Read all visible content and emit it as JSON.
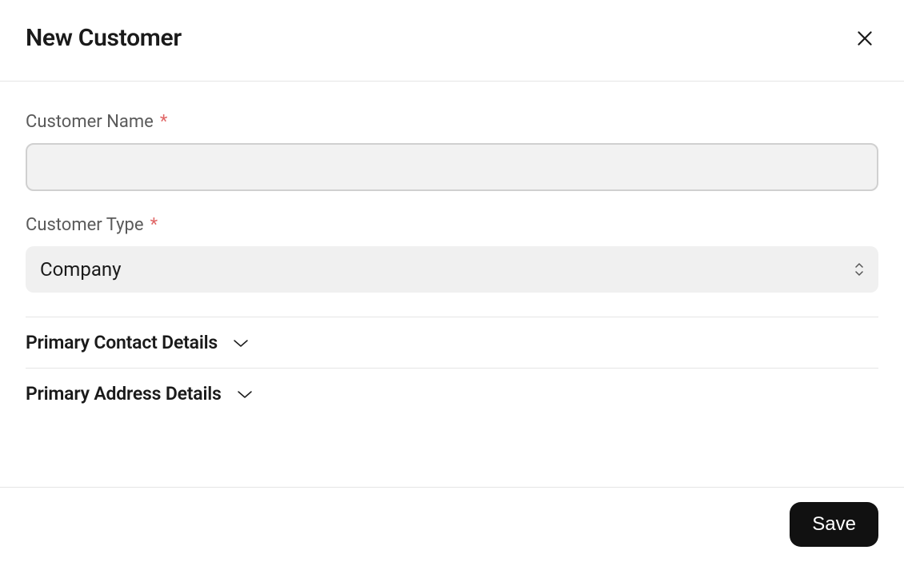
{
  "header": {
    "title": "New Customer"
  },
  "fields": {
    "customer_name": {
      "label": "Customer Name",
      "required": "*",
      "value": ""
    },
    "customer_type": {
      "label": "Customer Type",
      "required": "*",
      "selected": "Company"
    }
  },
  "sections": {
    "contact": {
      "title": "Primary Contact Details"
    },
    "address": {
      "title": "Primary Address Details"
    }
  },
  "footer": {
    "save_label": "Save"
  }
}
